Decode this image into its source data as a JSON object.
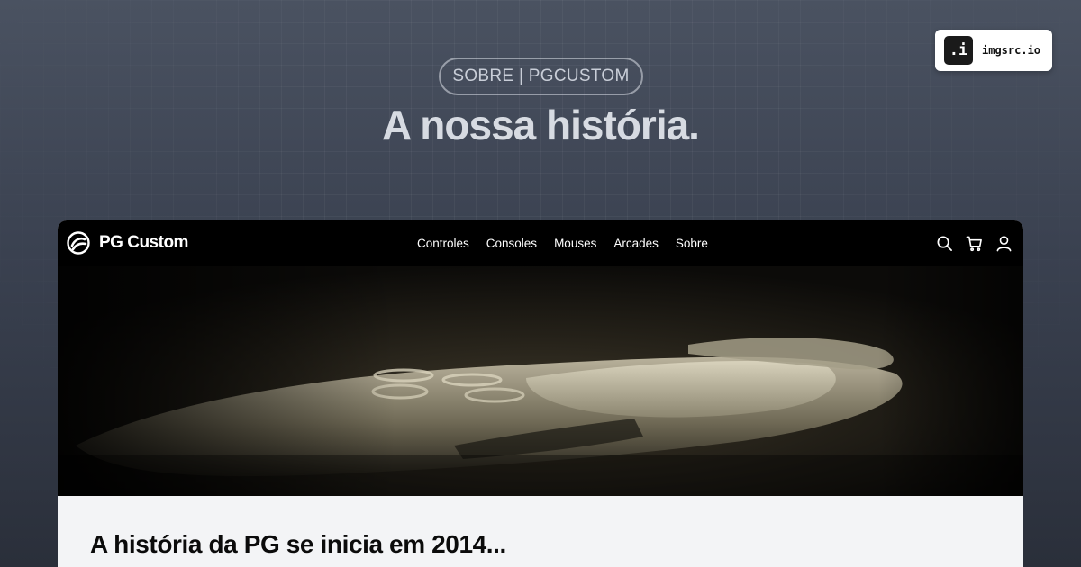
{
  "pill_label": "SOBRE | PGCUSTOM",
  "headline": "A nossa história.",
  "badge": {
    "icon_text": ".i",
    "label": "imgsrc.io"
  },
  "site": {
    "brand": "PG Custom",
    "menu": [
      "Controles",
      "Consoles",
      "Mouses",
      "Arcades",
      "Sobre"
    ],
    "icons": [
      "search-icon",
      "cart-icon",
      "user-icon"
    ],
    "hero_alt": "game controller close-up",
    "section_title": "A história da PG se inicia em 2014..."
  }
}
